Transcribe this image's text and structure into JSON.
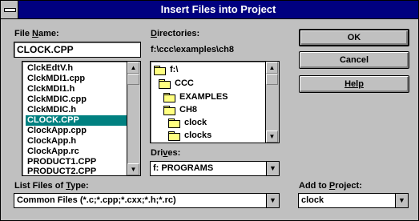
{
  "window": {
    "title": "Insert Files into Project"
  },
  "file_name": {
    "label_pre": "File ",
    "label_u": "N",
    "label_post": "ame:",
    "value": "CLOCK.CPP"
  },
  "file_list": {
    "items": [
      "ClckEdtV.h",
      "ClckMDI1.cpp",
      "ClckMDI1.h",
      "ClckMDIC.cpp",
      "ClckMDIC.h",
      "CLOCK.CPP",
      "ClockApp.cpp",
      "ClockApp.h",
      "ClockApp.rc",
      "PRODUCT1.CPP",
      "PRODUCT2.CPP"
    ],
    "selected": "CLOCK.CPP"
  },
  "directories": {
    "label_pre": "",
    "label_u": "D",
    "label_post": "irectories:",
    "path": "f:\\ccc\\examples\\ch8",
    "items": [
      "f:\\",
      "CCC",
      "EXAMPLES",
      "CH8",
      "clock",
      "clocks"
    ]
  },
  "drives": {
    "label_pre": "Dri",
    "label_u": "v",
    "label_post": "es:",
    "value": "f: PROGRAMS"
  },
  "file_type": {
    "label_pre": "List Files of ",
    "label_u": "T",
    "label_post": "ype:",
    "value": "Common Files (*.c;*.cpp;*.cxx;*.h;*.rc)"
  },
  "add_to_project": {
    "label_pre": "Add to ",
    "label_u": "P",
    "label_post": "roject:",
    "value": "clock"
  },
  "buttons": {
    "ok": "OK",
    "cancel": "Cancel",
    "help": "Help"
  },
  "icons": {
    "up": "▲",
    "down": "▼",
    "drop": "▼"
  }
}
